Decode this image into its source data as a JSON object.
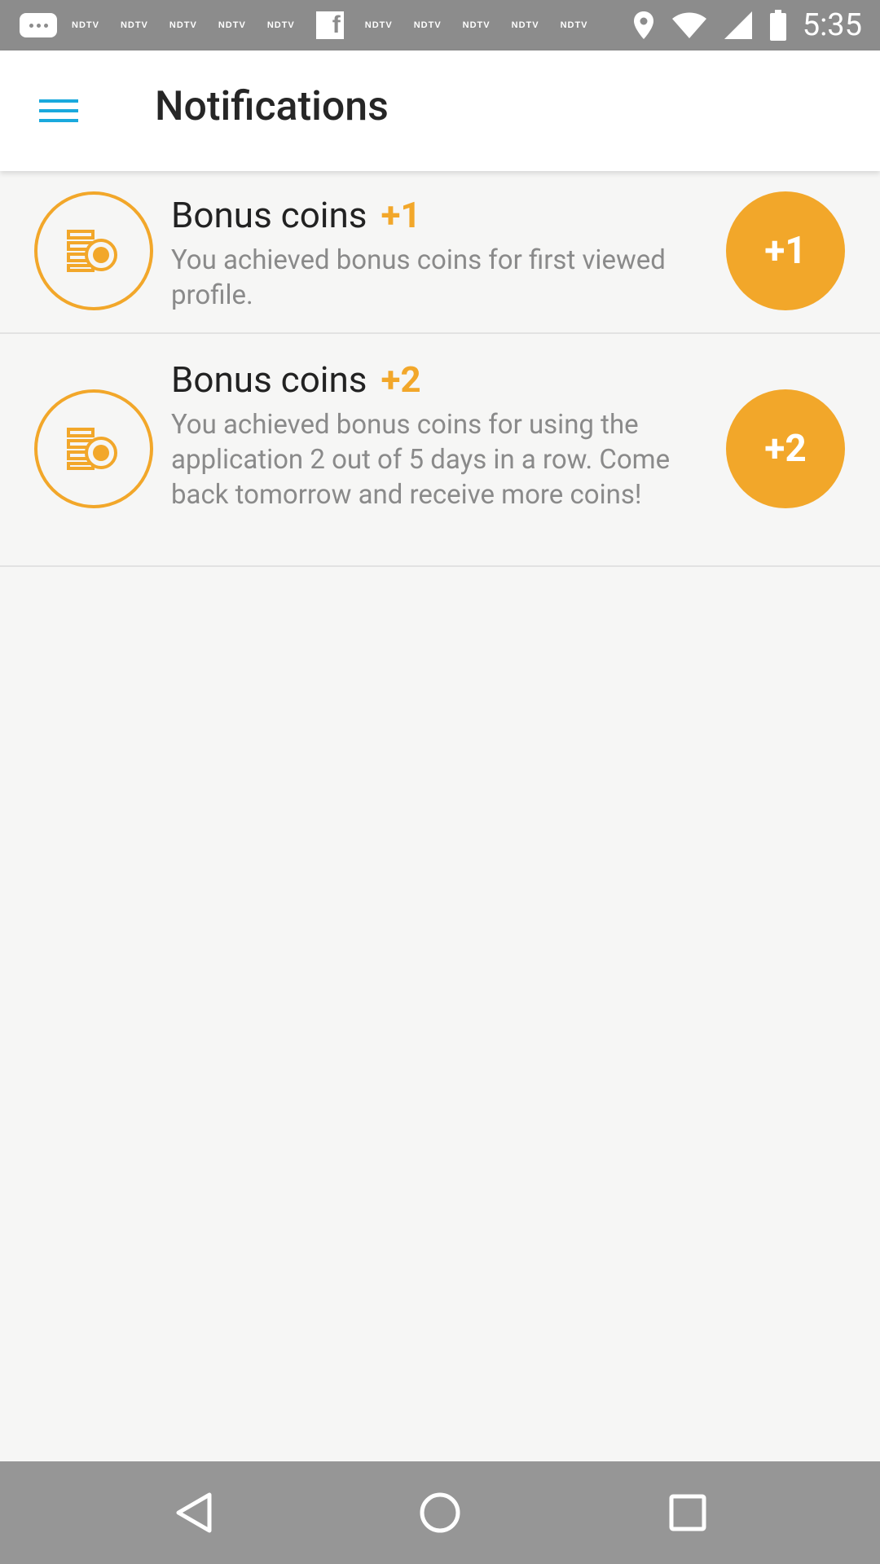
{
  "status_bar": {
    "time": "5:35",
    "notification_labels": [
      "NDTV",
      "NDTV",
      "NDTV",
      "NDTV",
      "NDTV",
      "NDTV",
      "NDTV",
      "NDTV",
      "NDTV",
      "NDTV"
    ],
    "icons": [
      "message-icon",
      "facebook-icon",
      "location-icon",
      "wifi-icon",
      "signal-icon",
      "battery-icon"
    ]
  },
  "app_bar": {
    "title": "Notifications",
    "menu_icon": "menu-icon"
  },
  "notifications": [
    {
      "title": "Bonus coins",
      "amount": "+1",
      "description": "You achieved bonus coins for first viewed profile.",
      "badge": "+1",
      "icon": "coins-icon"
    },
    {
      "title": "Bonus coins",
      "amount": "+2",
      "description": "You achieved bonus coins for using the application 2 out of 5 days in a row. Come back tomorrow and receive more coins!",
      "badge": "+2",
      "icon": "coins-icon"
    }
  ],
  "nav_bar": {
    "icons": [
      "back-icon",
      "home-icon",
      "recent-apps-icon"
    ]
  },
  "colors": {
    "accent": "#f2a72a",
    "menu": "#1aa9dd",
    "status_bar": "#8c8c8c",
    "nav_bar": "#969696",
    "background": "#f6f6f5"
  }
}
